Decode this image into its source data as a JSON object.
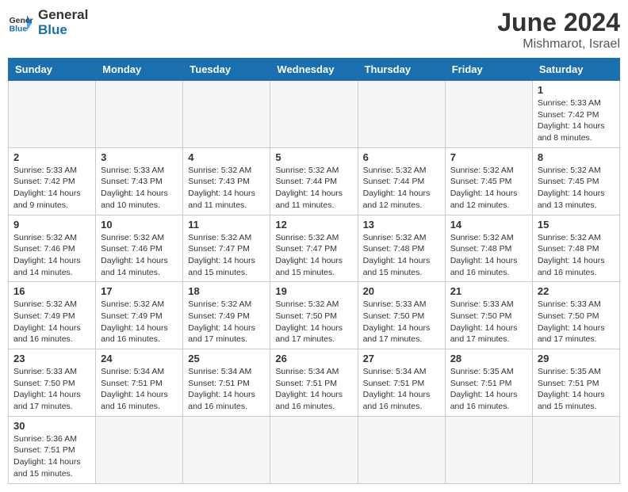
{
  "header": {
    "logo_general": "General",
    "logo_blue": "Blue",
    "month_year": "June 2024",
    "location": "Mishmarot, Israel"
  },
  "weekdays": [
    "Sunday",
    "Monday",
    "Tuesday",
    "Wednesday",
    "Thursday",
    "Friday",
    "Saturday"
  ],
  "weeks": [
    [
      {
        "day": "",
        "info": ""
      },
      {
        "day": "",
        "info": ""
      },
      {
        "day": "",
        "info": ""
      },
      {
        "day": "",
        "info": ""
      },
      {
        "day": "",
        "info": ""
      },
      {
        "day": "",
        "info": ""
      },
      {
        "day": "1",
        "info": "Sunrise: 5:33 AM\nSunset: 7:42 PM\nDaylight: 14 hours\nand 8 minutes."
      }
    ],
    [
      {
        "day": "2",
        "info": "Sunrise: 5:33 AM\nSunset: 7:42 PM\nDaylight: 14 hours\nand 9 minutes."
      },
      {
        "day": "3",
        "info": "Sunrise: 5:33 AM\nSunset: 7:43 PM\nDaylight: 14 hours\nand 10 minutes."
      },
      {
        "day": "4",
        "info": "Sunrise: 5:32 AM\nSunset: 7:43 PM\nDaylight: 14 hours\nand 11 minutes."
      },
      {
        "day": "5",
        "info": "Sunrise: 5:32 AM\nSunset: 7:44 PM\nDaylight: 14 hours\nand 11 minutes."
      },
      {
        "day": "6",
        "info": "Sunrise: 5:32 AM\nSunset: 7:44 PM\nDaylight: 14 hours\nand 12 minutes."
      },
      {
        "day": "7",
        "info": "Sunrise: 5:32 AM\nSunset: 7:45 PM\nDaylight: 14 hours\nand 12 minutes."
      },
      {
        "day": "8",
        "info": "Sunrise: 5:32 AM\nSunset: 7:45 PM\nDaylight: 14 hours\nand 13 minutes."
      }
    ],
    [
      {
        "day": "9",
        "info": "Sunrise: 5:32 AM\nSunset: 7:46 PM\nDaylight: 14 hours\nand 14 minutes."
      },
      {
        "day": "10",
        "info": "Sunrise: 5:32 AM\nSunset: 7:46 PM\nDaylight: 14 hours\nand 14 minutes."
      },
      {
        "day": "11",
        "info": "Sunrise: 5:32 AM\nSunset: 7:47 PM\nDaylight: 14 hours\nand 15 minutes."
      },
      {
        "day": "12",
        "info": "Sunrise: 5:32 AM\nSunset: 7:47 PM\nDaylight: 14 hours\nand 15 minutes."
      },
      {
        "day": "13",
        "info": "Sunrise: 5:32 AM\nSunset: 7:48 PM\nDaylight: 14 hours\nand 15 minutes."
      },
      {
        "day": "14",
        "info": "Sunrise: 5:32 AM\nSunset: 7:48 PM\nDaylight: 14 hours\nand 16 minutes."
      },
      {
        "day": "15",
        "info": "Sunrise: 5:32 AM\nSunset: 7:48 PM\nDaylight: 14 hours\nand 16 minutes."
      }
    ],
    [
      {
        "day": "16",
        "info": "Sunrise: 5:32 AM\nSunset: 7:49 PM\nDaylight: 14 hours\nand 16 minutes."
      },
      {
        "day": "17",
        "info": "Sunrise: 5:32 AM\nSunset: 7:49 PM\nDaylight: 14 hours\nand 16 minutes."
      },
      {
        "day": "18",
        "info": "Sunrise: 5:32 AM\nSunset: 7:49 PM\nDaylight: 14 hours\nand 17 minutes."
      },
      {
        "day": "19",
        "info": "Sunrise: 5:32 AM\nSunset: 7:50 PM\nDaylight: 14 hours\nand 17 minutes."
      },
      {
        "day": "20",
        "info": "Sunrise: 5:33 AM\nSunset: 7:50 PM\nDaylight: 14 hours\nand 17 minutes."
      },
      {
        "day": "21",
        "info": "Sunrise: 5:33 AM\nSunset: 7:50 PM\nDaylight: 14 hours\nand 17 minutes."
      },
      {
        "day": "22",
        "info": "Sunrise: 5:33 AM\nSunset: 7:50 PM\nDaylight: 14 hours\nand 17 minutes."
      }
    ],
    [
      {
        "day": "23",
        "info": "Sunrise: 5:33 AM\nSunset: 7:50 PM\nDaylight: 14 hours\nand 17 minutes."
      },
      {
        "day": "24",
        "info": "Sunrise: 5:34 AM\nSunset: 7:51 PM\nDaylight: 14 hours\nand 16 minutes."
      },
      {
        "day": "25",
        "info": "Sunrise: 5:34 AM\nSunset: 7:51 PM\nDaylight: 14 hours\nand 16 minutes."
      },
      {
        "day": "26",
        "info": "Sunrise: 5:34 AM\nSunset: 7:51 PM\nDaylight: 14 hours\nand 16 minutes."
      },
      {
        "day": "27",
        "info": "Sunrise: 5:34 AM\nSunset: 7:51 PM\nDaylight: 14 hours\nand 16 minutes."
      },
      {
        "day": "28",
        "info": "Sunrise: 5:35 AM\nSunset: 7:51 PM\nDaylight: 14 hours\nand 16 minutes."
      },
      {
        "day": "29",
        "info": "Sunrise: 5:35 AM\nSunset: 7:51 PM\nDaylight: 14 hours\nand 15 minutes."
      }
    ],
    [
      {
        "day": "30",
        "info": "Sunrise: 5:36 AM\nSunset: 7:51 PM\nDaylight: 14 hours\nand 15 minutes."
      },
      {
        "day": "",
        "info": ""
      },
      {
        "day": "",
        "info": ""
      },
      {
        "day": "",
        "info": ""
      },
      {
        "day": "",
        "info": ""
      },
      {
        "day": "",
        "info": ""
      },
      {
        "day": "",
        "info": ""
      }
    ]
  ]
}
